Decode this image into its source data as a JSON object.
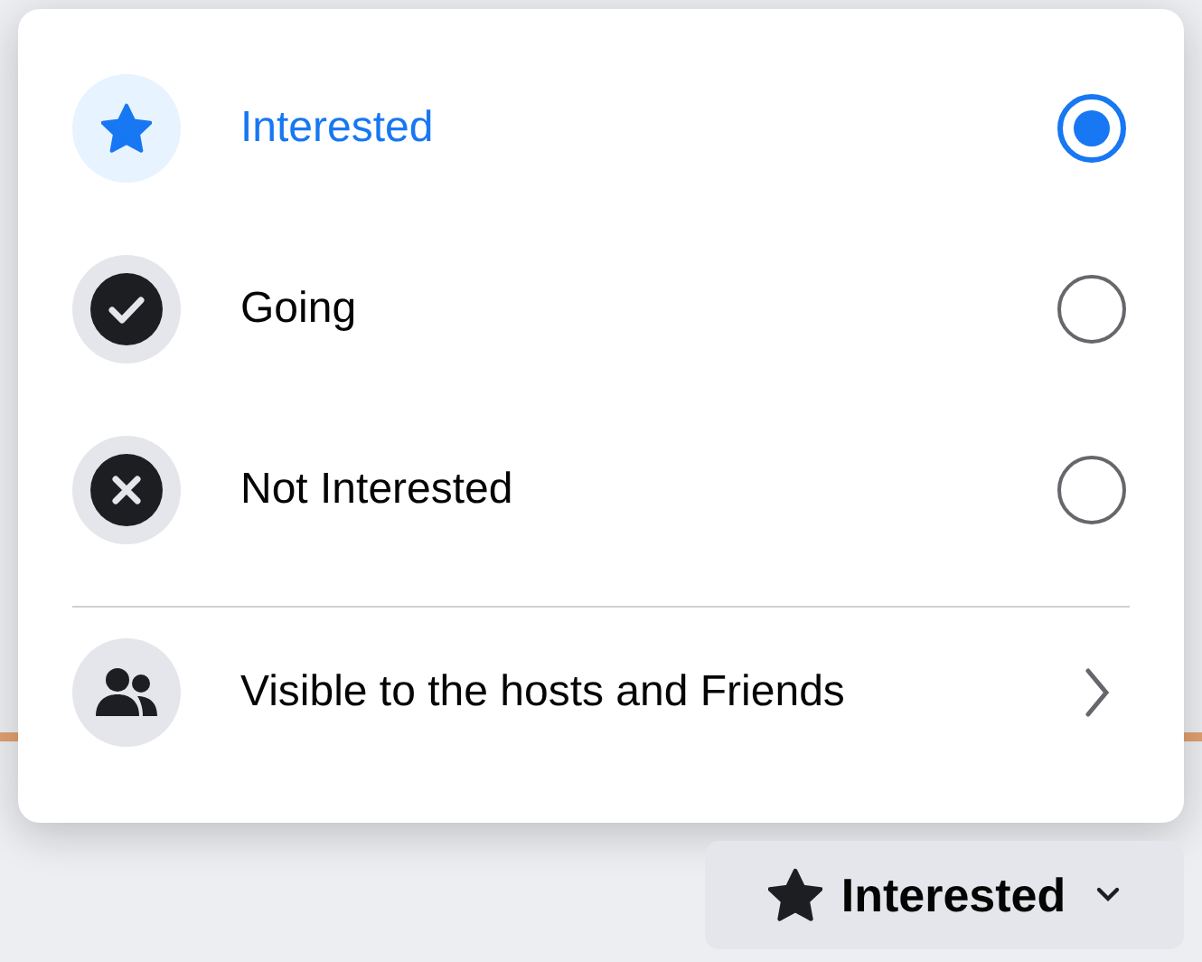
{
  "menu": {
    "options": [
      {
        "kind": "star",
        "label": "Interested",
        "selected": true
      },
      {
        "kind": "check",
        "label": "Going",
        "selected": false
      },
      {
        "kind": "cross",
        "label": "Not Interested",
        "selected": false
      }
    ],
    "audience": {
      "label": "Visible to the hosts and Friends"
    }
  },
  "button": {
    "label": "Interested"
  }
}
